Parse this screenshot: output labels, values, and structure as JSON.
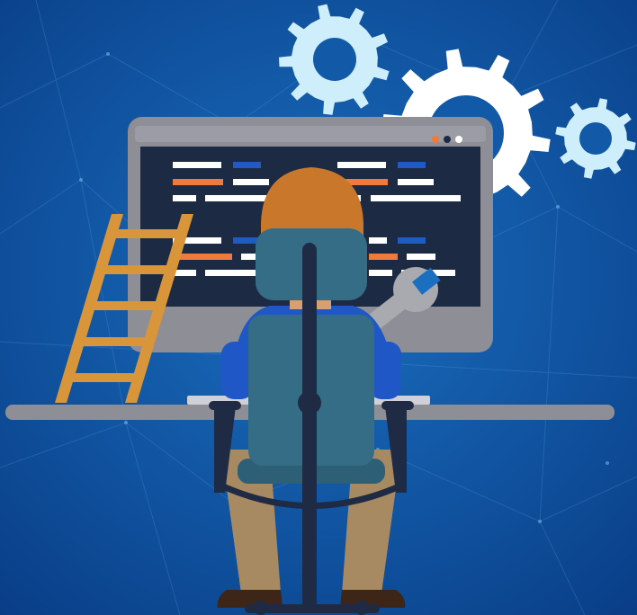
{
  "scene": {
    "title": "",
    "background": {
      "center": "#1a6fc0",
      "edge": "#093d86"
    },
    "colors": {
      "gear": "#cdeefa",
      "gear_white": "#ffffff",
      "monitor_frame": "#8e8e96",
      "monitor_bezel": "#9c9ca6",
      "screen": "#1d2a44",
      "code_white": "#ffffff",
      "code_orange": "#f07a3a",
      "code_blue": "#1f5bc2",
      "ladder": "#d9953a",
      "desk": "#8e8e96",
      "hair": "#c9782b",
      "shirt": "#1f57c7",
      "chair": "#356d86",
      "chair_dark": "#1f2a44",
      "pants": "#a88a62",
      "shoes": "#3d2518",
      "wrench": "#a9a9b0"
    },
    "window_dots": [
      "#f07a3a",
      "#1d2a44",
      "#ffffff"
    ],
    "icons": [
      "gear-icon",
      "gear-icon",
      "gear-icon",
      "wrench-icon",
      "ladder-icon",
      "monitor-icon",
      "office-chair-icon"
    ]
  }
}
